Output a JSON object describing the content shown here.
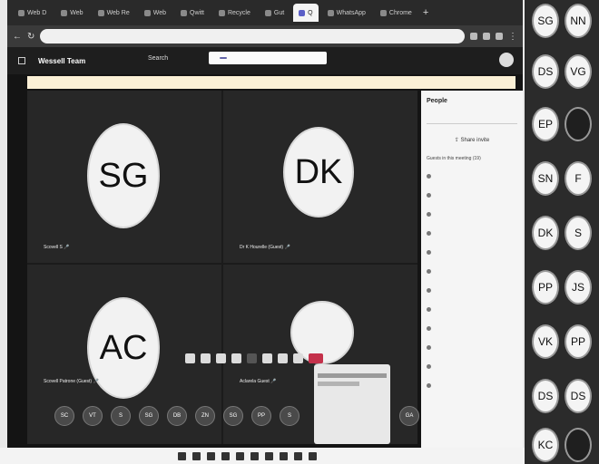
{
  "browser": {
    "tabs": [
      {
        "label": "Web D"
      },
      {
        "label": "Web"
      },
      {
        "label": "Web Re"
      },
      {
        "label": "Web"
      },
      {
        "label": "Qwitt"
      },
      {
        "label": "Recycle"
      },
      {
        "label": "Gut"
      },
      {
        "label": "Q",
        "active": true
      },
      {
        "label": "WhatsApp"
      },
      {
        "label": "Chrome"
      }
    ]
  },
  "teams": {
    "meeting_title": "Wessell Team",
    "search_label": "Search"
  },
  "tiles": [
    {
      "initials": "SG",
      "name": "Scovell S"
    },
    {
      "initials": "DK",
      "name": "Dr K Hourelle (Guest)"
    },
    {
      "initials": "AC",
      "name": "Scovell Patrone (Guest)"
    },
    {
      "initials": "",
      "name": "Aclarela Guest"
    }
  ],
  "avatar_row": [
    "SC",
    "VT",
    "S",
    "SG",
    "DB",
    "ZN",
    "SG",
    "PP",
    "S",
    "GA"
  ],
  "people_panel": {
    "title": "People",
    "share_label": "Share invite",
    "in_meeting_label": "Guests in this meeting (19)"
  },
  "sidebar_tiles": [
    {
      "initials": "SG",
      "dark": false
    },
    {
      "initials": "NN",
      "dark": false
    },
    {
      "initials": "DS",
      "dark": false
    },
    {
      "initials": "VG",
      "dark": false
    },
    {
      "initials": "EP",
      "dark": false
    },
    {
      "initials": "",
      "dark": true
    },
    {
      "initials": "SN",
      "dark": false
    },
    {
      "initials": "F",
      "dark": false
    },
    {
      "initials": "DK",
      "dark": false
    },
    {
      "initials": "S",
      "dark": false
    },
    {
      "initials": "PP",
      "dark": false
    },
    {
      "initials": "JS",
      "dark": false
    },
    {
      "initials": "VK",
      "dark": false
    },
    {
      "initials": "PP",
      "dark": false
    },
    {
      "initials": "DS",
      "dark": false
    },
    {
      "initials": "DS",
      "dark": false
    },
    {
      "initials": "KC",
      "dark": false
    },
    {
      "initials": "",
      "dark": true
    }
  ]
}
